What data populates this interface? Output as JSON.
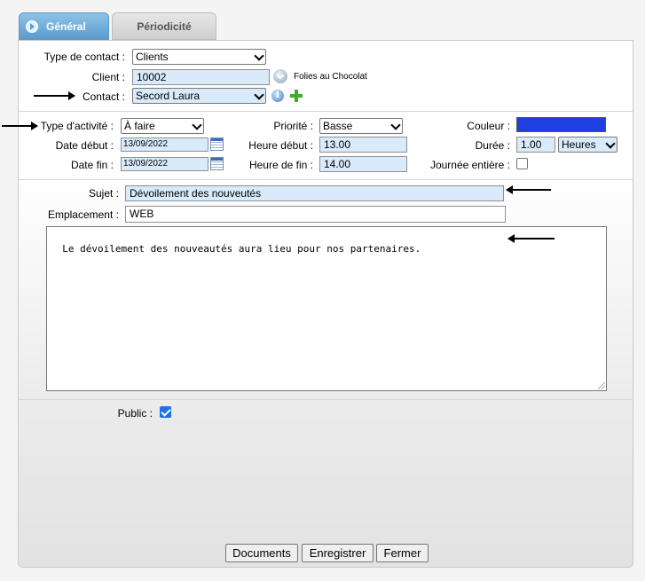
{
  "tabs": [
    {
      "label": "Général",
      "active": true
    },
    {
      "label": "Périodicité",
      "active": false
    }
  ],
  "contact": {
    "type_label": "Type de contact :",
    "type_value": "Clients",
    "client_label": "Client :",
    "client_value": "10002",
    "client_name": "Folies au Chocolat",
    "contact_label": "Contact :",
    "contact_value": "Secord Laura"
  },
  "activity": {
    "type_label": "Type d'activité :",
    "type_value": "À faire",
    "priority_label": "Priorité :",
    "priority_value": "Basse",
    "color_label": "Couleur :",
    "color_value": "#1f3fe0",
    "start_date_label": "Date début :",
    "start_date": "13/09/2022",
    "start_time_label": "Heure début :",
    "start_time": "13.00",
    "duration_label": "Durée :",
    "duration_value": "1.00",
    "duration_unit": "Heures",
    "end_date_label": "Date fin :",
    "end_date": "13/09/2022",
    "end_time_label": "Heure de fin :",
    "end_time": "14.00",
    "all_day_label": "Journée entière :",
    "all_day": false
  },
  "details": {
    "subject_label": "Sujet :",
    "subject_value": "Dévoilement des nouveutés",
    "location_label": "Emplacement :",
    "location_value": "WEB",
    "notes": "Le dévoilement des nouveautés aura lieu pour nos partenaires."
  },
  "public": {
    "label": "Public :",
    "checked": true
  },
  "buttons": {
    "documents": "Documents",
    "save": "Enregistrer",
    "close": "Fermer"
  }
}
